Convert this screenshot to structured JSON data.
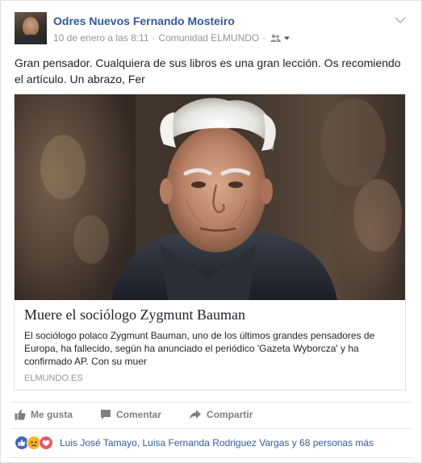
{
  "post": {
    "author": "Odres Nuevos Fernando Mosteiro",
    "date": "10 de enero a las 8:11",
    "separator": "·",
    "group": "Comunidad ELMUNDO",
    "text": "Gran pensador. Cualquiera de sus libros es una gran lección. Os recomiendo el artículo. Un abrazo, Fer"
  },
  "link": {
    "title": "Muere el sociólogo Zygmunt Bauman",
    "description": "El sociólogo polaco Zygmunt Bauman, uno de los últimos grandes pensadores de Europa, ha fallecido, según ha anunciado el periódico 'Gazeta Wyborcza' y ha confirmado AP. Con su muer",
    "domain": "ELMUNDO.ES"
  },
  "actions": {
    "like": "Me gusta",
    "comment": "Comentar",
    "share": "Compartir"
  },
  "reactions": {
    "text": "Luis José Tamayo, Luisa Fernanda Rodriguez Vargas y 68 personas más",
    "icons": [
      "like-reaction-icon",
      "sad-reaction-icon",
      "love-reaction-icon"
    ]
  },
  "colors": {
    "link_blue": "#365899",
    "like_blue": "#4267b2",
    "love_red": "#f25268",
    "sad_yellow": "#f7b125"
  }
}
